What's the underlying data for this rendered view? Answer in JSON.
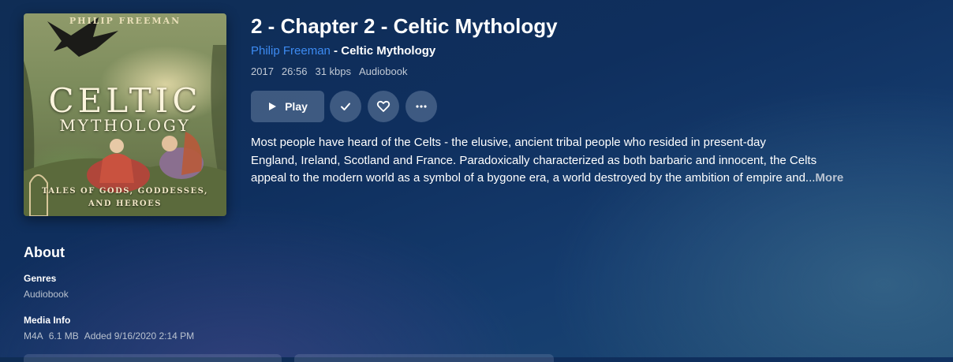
{
  "cover": {
    "author": "PHILIP FREEMAN",
    "title_line1": "CELTIC",
    "title_line2": "MYTHOLOGY",
    "subtitle_line1": "TALES OF GODS, GODDESSES,",
    "subtitle_line2": "AND HEROES"
  },
  "track": {
    "title": "2 - Chapter 2 - Celtic Mythology",
    "artist": "Philip Freeman",
    "separator": " - ",
    "album": "Celtic Mythology",
    "meta": {
      "year": "2017",
      "duration": "26:56",
      "bitrate": "31 kbps",
      "genre": "Audiobook"
    }
  },
  "actions": {
    "play_label": "Play",
    "icons": [
      "play-icon",
      "check-icon",
      "heart-icon",
      "more-icon"
    ]
  },
  "description": {
    "line1": "Most people have heard of the Celts - the elusive, ancient tribal people who resided in present-day",
    "line2": "England, Ireland, Scotland and France. Paradoxically characterized as both barbaric and innocent, the Celts",
    "line3": "appeal to the modern world as a symbol of a bygone era, a world destroyed by the ambition of empire and...",
    "more_label": "More"
  },
  "about": {
    "heading": "About",
    "genres_label": "Genres",
    "genres_value": "Audiobook",
    "media_label": "Media Info",
    "media": {
      "format": "M4A",
      "size": "6.1 MB",
      "added": "Added 9/16/2020 2:14 PM"
    }
  },
  "colors": {
    "accent_link": "#3d8bf2",
    "background_top": "#0f2d55",
    "button_bg": "rgba(140,160,190,0.38)"
  }
}
